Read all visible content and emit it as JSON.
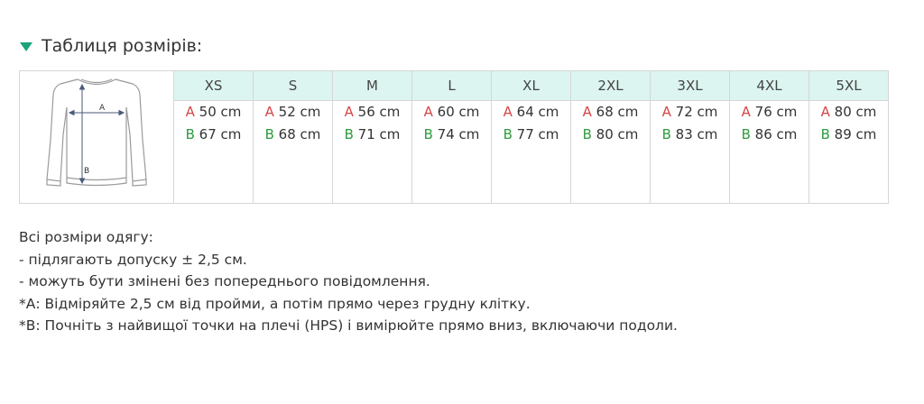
{
  "header": {
    "title": "Таблиця розмірів:",
    "icon": "caret-down-icon",
    "accent": "#1ba37a"
  },
  "diagram": {
    "label_a": "A",
    "label_b": "B"
  },
  "table": {
    "header_bg": "#dcf5f0",
    "color_a": "#d64545",
    "color_b": "#2e9a3e",
    "sizes": [
      {
        "label": "XS",
        "a_letter": "A",
        "a_value": "50 cm",
        "b_letter": "B",
        "b_value": "67 cm"
      },
      {
        "label": "S",
        "a_letter": "A",
        "a_value": "52 cm",
        "b_letter": "B",
        "b_value": "68 cm"
      },
      {
        "label": "M",
        "a_letter": "A",
        "a_value": "56 cm",
        "b_letter": "B",
        "b_value": "71 cm"
      },
      {
        "label": "L",
        "a_letter": "A",
        "a_value": "60 cm",
        "b_letter": "B",
        "b_value": "74 cm"
      },
      {
        "label": "XL",
        "a_letter": "A",
        "a_value": "64 cm",
        "b_letter": "B",
        "b_value": "77 cm"
      },
      {
        "label": "2XL",
        "a_letter": "A",
        "a_value": "68 cm",
        "b_letter": "B",
        "b_value": "80 cm"
      },
      {
        "label": "3XL",
        "a_letter": "A",
        "a_value": "72 cm",
        "b_letter": "B",
        "b_value": "83 cm"
      },
      {
        "label": "4XL",
        "a_letter": "A",
        "a_value": "76 cm",
        "b_letter": "B",
        "b_value": "86 cm"
      },
      {
        "label": "5XL",
        "a_letter": "A",
        "a_value": "80 cm",
        "b_letter": "B",
        "b_value": "89 cm"
      }
    ]
  },
  "notes": [
    "Всі розміри одягу:",
    "- підлягають допуску ± 2,5 см.",
    "- можуть бути змінені без попереднього повідомлення.",
    "*А: Відміряйте 2,5 см від пройми, а потім прямо через грудну клітку.",
    "*В: Почніть з найвищої точки на плечі (HPS) і вимірюйте прямо вниз, включаючи подоли."
  ]
}
